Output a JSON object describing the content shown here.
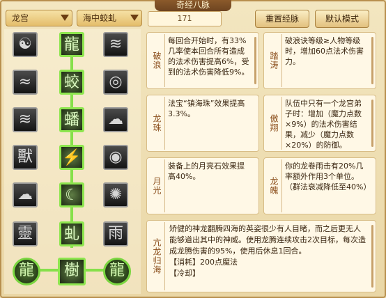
{
  "title": "奇经八脉",
  "school_dropdown": "龙宫",
  "path_dropdown": "海中蛟虬",
  "points_value": "171",
  "buttons": {
    "reset": "重置经脉",
    "default": "默认模式"
  },
  "skills": [
    {
      "name": "破浪",
      "desc": "每回合开始时，有33%几率使本回合所有造成的法术伤害提高6%，受到的法术伤害降低9%。"
    },
    {
      "name": "踏涛",
      "desc": "破浪诀等级≥人物等级时，增加60点法术伤害力。"
    },
    {
      "name": "龙珠",
      "desc": "法宝“镇海珠”效果提高3.3%。"
    },
    {
      "name": "傲翔",
      "desc": "队伍中只有一个龙宫弟子时：增加（魔力点数×9%）的法术伤害结果，减少（魔力点数×20%）的防御。"
    },
    {
      "name": "月光",
      "desc": "装备上的月亮石效果提高40%。"
    },
    {
      "name": "龙魄",
      "desc": "你的龙卷雨击有20%几率额外作用3个单位。（群法衰减降低至40%）"
    },
    {
      "name": "亢龙归海",
      "desc": "矫健的神龙翻腾四海的英姿很少有人目睹，而之后更无人能够道出其中的神威。使用龙腾连续攻击2次目标，每次造成龙腾伤害的95%，使用后休息1回合。",
      "cost": "【消耗】200点魔法",
      "extra": "【冷却】"
    }
  ],
  "icons": {
    "row1": [
      "wind-swirl-icon",
      "dragon-icon",
      "wave-icon"
    ],
    "row2": [
      "water-icon",
      "sea-dragon-icon",
      "vortex-icon"
    ],
    "row3": [
      "flood-icon",
      "dragon-coil-icon",
      "mist-icon"
    ],
    "row4": [
      "beast-icon",
      "lightning-dragon-icon",
      "pearl-icon"
    ],
    "row5": [
      "cloud-icon",
      "moon-icon",
      "storm-icon"
    ],
    "row6": [
      "spirit-icon",
      "serpent-icon",
      "rain-icon"
    ],
    "row7": [
      "dragon-orb-icon",
      "dragon-totem-icon",
      "dragon-orb-icon"
    ]
  },
  "colors": {
    "active_border": "#8ee64f",
    "panel_bg": "#efe0b5",
    "title_bg": "#6d4420"
  }
}
